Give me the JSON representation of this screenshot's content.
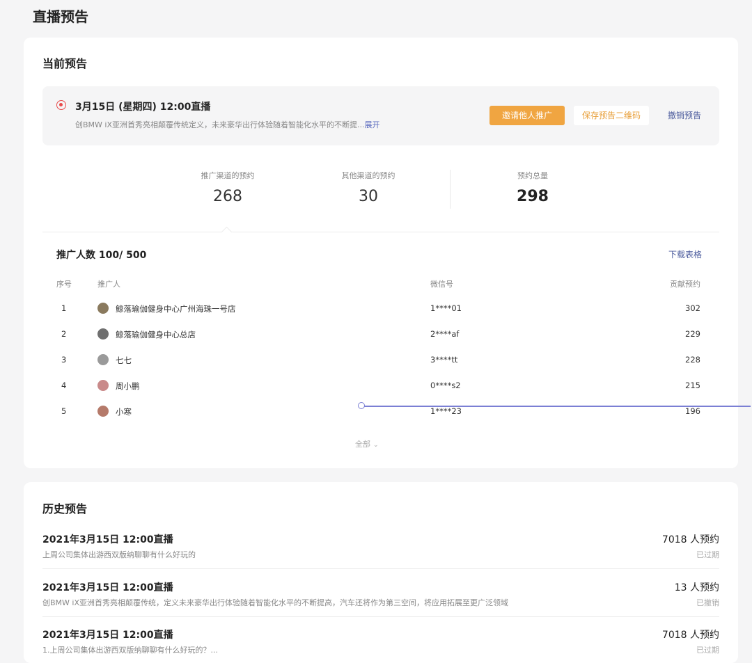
{
  "page": {
    "title": "直播预告"
  },
  "current": {
    "section_title": "当前预告",
    "banner": {
      "title": "3月15日 (星期四) 12:00直播",
      "description": "创BMW iX亚洲首秀亮相颠覆传统定义，未来豪华出行体验随着智能化水平的不断提...",
      "expand_label": "展开",
      "invite_button": "邀请他人推广",
      "save_qr_button": "保存预告二维码",
      "revoke_button": "撤销预告"
    },
    "stats": [
      {
        "label": "推广渠道的预约",
        "value": "268"
      },
      {
        "label": "其他渠道的预约",
        "value": "30"
      },
      {
        "label": "预约总量",
        "value": "298"
      }
    ],
    "promoters": {
      "count_label": "推广人数 100/ 500",
      "download_label": "下载表格",
      "headers": {
        "index": "序号",
        "promoter": "推广人",
        "wechat": "微信号",
        "contribution": "贡献预约"
      },
      "rows": [
        {
          "index": "1",
          "name": "鲸落瑜伽健身中心广州海珠一号店",
          "wechat": "1****01",
          "count": "302",
          "avatar_color": "#8a7a5e"
        },
        {
          "index": "2",
          "name": "鲸落瑜伽健身中心总店",
          "wechat": "2****af",
          "count": "229",
          "avatar_color": "#6f6f6f"
        },
        {
          "index": "3",
          "name": "七七",
          "wechat": "3****tt",
          "count": "228",
          "avatar_color": "#9a9a9a"
        },
        {
          "index": "4",
          "name": "周小鹏",
          "wechat": "0****s2",
          "count": "215",
          "avatar_color": "#c98a8a"
        },
        {
          "index": "5",
          "name": "小寒",
          "wechat": "1****23",
          "count": "196",
          "avatar_color": "#b57a6a"
        }
      ],
      "more_label": "全部"
    }
  },
  "history": {
    "section_title": "历史预告",
    "items": [
      {
        "title": "2021年3月15日 12:00直播",
        "description": "上周公司集体出游西双版纳聊聊有什么好玩的",
        "count": "7018 人预约",
        "status": "已过期"
      },
      {
        "title": "2021年3月15日 12:00直播",
        "description": "创BMW iX亚洲首秀亮相颠覆传统，定义未来豪华出行体验随着智能化水平的不断提高，汽车还将作为第三空间，将应用拓展至更广泛领域",
        "count": "13 人预约",
        "status": "已撤销"
      },
      {
        "title": "2021年3月15日 12:00直播",
        "description": "1.上周公司集体出游西双版纳聊聊有什么好玩的？...",
        "count": "7018 人预约",
        "status": "已过期"
      }
    ]
  },
  "colors": {
    "accent_orange": "#f0a541",
    "link_blue": "#4a5a9c",
    "live_red": "#e84a4a",
    "pointer": "#7b7fd4"
  }
}
